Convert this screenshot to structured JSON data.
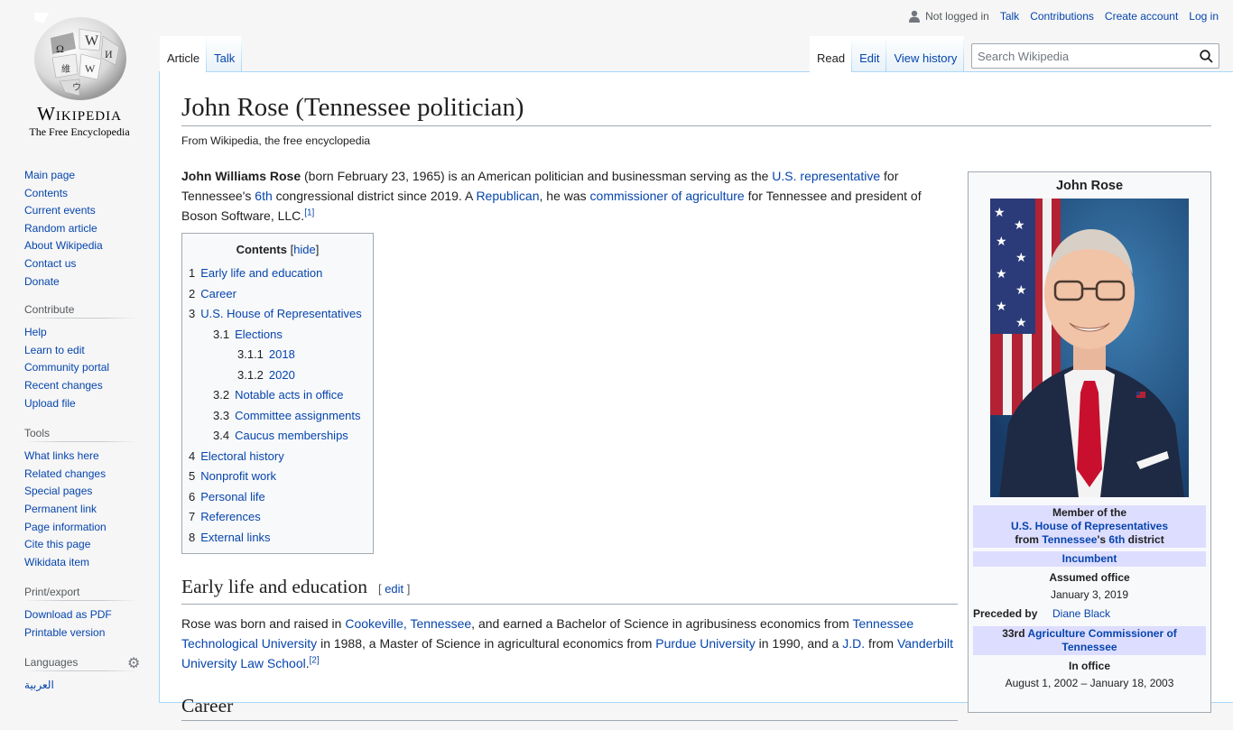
{
  "logo": {
    "wordmark": "Wikipedia",
    "tagline": "The Free Encyclopedia"
  },
  "sidebar": {
    "navigation": [
      "Main page",
      "Contents",
      "Current events",
      "Random article",
      "About Wikipedia",
      "Contact us",
      "Donate"
    ],
    "contribute": {
      "heading": "Contribute",
      "items": [
        "Help",
        "Learn to edit",
        "Community portal",
        "Recent changes",
        "Upload file"
      ]
    },
    "tools": {
      "heading": "Tools",
      "items": [
        "What links here",
        "Related changes",
        "Special pages",
        "Permanent link",
        "Page information",
        "Cite this page",
        "Wikidata item"
      ]
    },
    "print": {
      "heading": "Print/export",
      "items": [
        "Download as PDF",
        "Printable version"
      ]
    },
    "languages": {
      "heading": "Languages",
      "items": [
        "العربية"
      ]
    }
  },
  "personal": {
    "not_logged_in": "Not logged in",
    "talk": "Talk",
    "contributions": "Contributions",
    "create_account": "Create account",
    "log_in": "Log in"
  },
  "tabs": {
    "article": "Article",
    "talk": "Talk",
    "read": "Read",
    "edit": "Edit",
    "view_history": "View history"
  },
  "search": {
    "placeholder": "Search Wikipedia"
  },
  "article": {
    "title": "John Rose (Tennessee politician)",
    "site_sub": "From Wikipedia, the free encyclopedia",
    "lead": {
      "bold": "John Williams Rose",
      "t1": " (born February 23, 1965) is an American politician and businessman serving as the ",
      "l1": "U.S. representative",
      "t2": " for Tennessee's ",
      "l2": "6th",
      "t3": " congressional district since 2019. A ",
      "l3": "Republican",
      "t4": ", he was ",
      "l4": "commissioner of agriculture",
      "t5": " for Tennessee and president of Boson Software, LLC.",
      "ref": "[1]"
    },
    "toc": {
      "title": "Contents",
      "hide": "hide",
      "items": [
        {
          "num": "1",
          "text": "Early life and education",
          "level": 1
        },
        {
          "num": "2",
          "text": "Career",
          "level": 1
        },
        {
          "num": "3",
          "text": "U.S. House of Representatives",
          "level": 1
        },
        {
          "num": "3.1",
          "text": "Elections",
          "level": 2
        },
        {
          "num": "3.1.1",
          "text": "2018",
          "level": 3
        },
        {
          "num": "3.1.2",
          "text": "2020",
          "level": 3
        },
        {
          "num": "3.2",
          "text": "Notable acts in office",
          "level": 2
        },
        {
          "num": "3.3",
          "text": "Committee assignments",
          "level": 2
        },
        {
          "num": "3.4",
          "text": "Caucus memberships",
          "level": 2
        },
        {
          "num": "4",
          "text": "Electoral history",
          "level": 1
        },
        {
          "num": "5",
          "text": "Nonprofit work",
          "level": 1
        },
        {
          "num": "6",
          "text": "Personal life",
          "level": 1
        },
        {
          "num": "7",
          "text": "References",
          "level": 1
        },
        {
          "num": "8",
          "text": "External links",
          "level": 1
        }
      ]
    },
    "section1": {
      "heading": "Early life and education",
      "edit": "edit",
      "t1": "Rose was born and raised in ",
      "l1": "Cookeville, Tennessee",
      "t2": ", and earned a Bachelor of Science in agribusiness economics from ",
      "l2": "Tennessee Technological University",
      "t3": " in 1988, a Master of Science in agricultural economics from ",
      "l3": "Purdue University",
      "t4": " in 1990, and a ",
      "l4": "J.D.",
      "t5": " from ",
      "l5": "Vanderbilt University Law School",
      "t6": ".",
      "ref": "[2]"
    },
    "section2": {
      "heading": "Career"
    }
  },
  "infobox": {
    "name": "John Rose",
    "office1": {
      "line1": "Member of the",
      "house_link": "U.S. House of Representatives",
      "from": "from ",
      "state_link": "Tennessee",
      "apostrophe": "'s ",
      "district_link": "6th",
      "district": " district"
    },
    "incumbent": "Incumbent",
    "assumed_office_label": "Assumed office",
    "assumed_office_date": "January 3, 2019",
    "preceded_by_label": "Preceded by",
    "preceded_by": "Diane Black",
    "office2": {
      "prefix": "33rd ",
      "link": "Agriculture Commissioner of Tennessee"
    },
    "in_office_label": "In office",
    "in_office_dates": "August 1, 2002 – January 18, 2003"
  }
}
